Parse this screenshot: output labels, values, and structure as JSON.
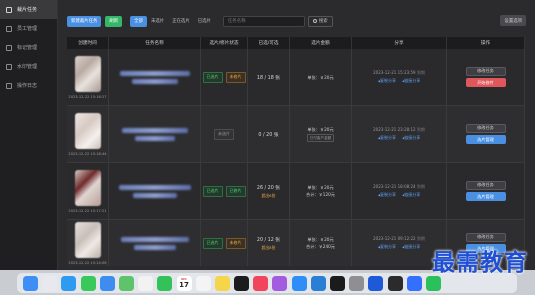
{
  "sidebar": {
    "items": [
      {
        "label": "裁片任务",
        "icon": "task-icon",
        "active": true
      },
      {
        "label": "员工管理",
        "icon": "users-icon",
        "active": false
      },
      {
        "label": "标记管理",
        "icon": "tag-icon",
        "active": false
      },
      {
        "label": "水印管理",
        "icon": "image-icon",
        "active": false
      },
      {
        "label": "操作日志",
        "icon": "log-icon",
        "active": false
      }
    ]
  },
  "toolbar": {
    "new_task_label": "新建裁片任务",
    "refresh_label": "刷新",
    "tabs": [
      "全部",
      "未选片",
      "正在选片",
      "已选片"
    ],
    "active_tab": "全部",
    "search_placeholder": "任务名称",
    "search_button": "搜索",
    "settings_label": "设置选项"
  },
  "table": {
    "headers": [
      "创建时间",
      "任务名称",
      "选片/修片状态",
      "已选/可选",
      "选片金额",
      "分享",
      "操作"
    ],
    "rows": [
      {
        "created": "2023-12-22 15:16:27",
        "status_tags": [
          {
            "text": "已选片",
            "tone": "green"
          },
          {
            "text": "未修片",
            "tone": "orange"
          }
        ],
        "count": "18 / 18 张",
        "count_note": "",
        "amount_lines": [
          "单张：￥20元"
        ],
        "amount_note": "",
        "share_time": "2023-12-21 15:23:59",
        "share_time_label": "到期",
        "share_links": [
          "复制分享",
          "链接分享"
        ],
        "actions": [
          {
            "label": "修改任务",
            "style": "gray"
          },
          {
            "label": "开始修片",
            "style": "red"
          }
        ]
      },
      {
        "created": "2023-12-22 15:18:44",
        "status_tags": [
          {
            "text": "未选片",
            "tone": "gray"
          }
        ],
        "count": "0 / 20 张",
        "count_note": "",
        "amount_lines": [
          "单张：￥20元"
        ],
        "amount_note": "已付客户金额",
        "share_time": "2023-12-21 23:28:12",
        "share_time_label": "到期",
        "share_links": [
          "复制分享",
          "链接分享"
        ],
        "actions": [
          {
            "label": "修改任务",
            "style": "gray"
          },
          {
            "label": "选片管理",
            "style": "blue"
          }
        ]
      },
      {
        "created": "2023-12-22 15:17:21",
        "status_tags": [
          {
            "text": "已选片",
            "tone": "green"
          },
          {
            "text": "已修片",
            "tone": "green"
          }
        ],
        "count": "26 / 20 张",
        "count_note": "超出6张",
        "amount_lines": [
          "单张：￥20元",
          "合计：￥120元"
        ],
        "amount_note": "",
        "share_time": "2023-12-21 18:08:24",
        "share_time_label": "到期",
        "share_links": [
          "复制分享",
          "链接分享"
        ],
        "actions": [
          {
            "label": "修改任务",
            "style": "gray"
          },
          {
            "label": "选片管理",
            "style": "blue"
          }
        ]
      },
      {
        "created": "2023-12-22 15:14:06",
        "status_tags": [
          {
            "text": "已选片",
            "tone": "green"
          },
          {
            "text": "未修片",
            "tone": "orange"
          }
        ],
        "count": "20 / 12 张",
        "count_note": "超出8张",
        "amount_lines": [
          "单张：￥20元",
          "合计：￥240元"
        ],
        "amount_note": "",
        "share_time": "2023-12-21 09:12:22",
        "share_time_label": "到期",
        "share_links": [
          "复制分享",
          "链接分享"
        ],
        "actions": [
          {
            "label": "修改任务",
            "style": "gray"
          },
          {
            "label": "选片管理",
            "style": "blue"
          }
        ]
      }
    ]
  },
  "dock": {
    "calendar_day": "17",
    "calendar_month": "DEC",
    "apps": [
      {
        "name": "finder-icon",
        "color": "#3f8ef5"
      },
      {
        "name": "launchpad-icon",
        "color": "#e8e8ee"
      },
      {
        "name": "safari-icon",
        "color": "#2e9bf0"
      },
      {
        "name": "messages-icon",
        "color": "#38c95a"
      },
      {
        "name": "mail-icon",
        "color": "#3d8cf0"
      },
      {
        "name": "maps-icon",
        "color": "#5ec36a"
      },
      {
        "name": "photos-icon",
        "color": "#f2f2f2"
      },
      {
        "name": "facetime-icon",
        "color": "#34c15a"
      },
      {
        "name": "calendar-icon",
        "color": "#ffffff"
      },
      {
        "name": "reminders-icon",
        "color": "#f4f4f4"
      },
      {
        "name": "notes-icon",
        "color": "#f5d64a"
      },
      {
        "name": "tv-icon",
        "color": "#1c1c1c"
      },
      {
        "name": "music-icon",
        "color": "#f0455b"
      },
      {
        "name": "podcasts-icon",
        "color": "#a35be0"
      },
      {
        "name": "app-store-icon",
        "color": "#2f8ef5"
      },
      {
        "name": "vscode-icon",
        "color": "#2a7fd4"
      },
      {
        "name": "pycharm-icon",
        "color": "#1b1b1b"
      },
      {
        "name": "settings-icon",
        "color": "#8e8e93"
      },
      {
        "name": "onepassword-icon",
        "color": "#1e5ad8"
      },
      {
        "name": "terminal-icon",
        "color": "#2b2b2b"
      },
      {
        "name": "feishu-icon",
        "color": "#3370ff"
      },
      {
        "name": "wechat-icon",
        "color": "#2bc15a"
      }
    ]
  },
  "watermark": "最需教育"
}
